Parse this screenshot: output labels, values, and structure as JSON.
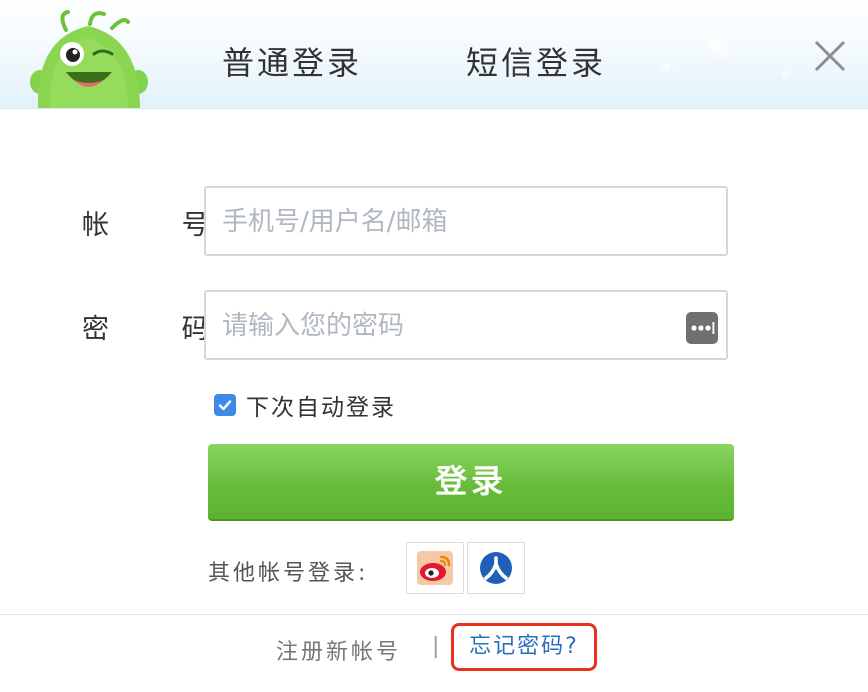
{
  "header": {
    "tabs": [
      {
        "label": "普通登录"
      },
      {
        "label": "短信登录"
      }
    ]
  },
  "form": {
    "account_label": "帐 号",
    "account_placeholder": "手机号/用户名/邮箱",
    "password_label": "密 码",
    "password_placeholder": "请输入您的密码",
    "remember_label": "下次自动登录",
    "remember_checked": true,
    "login_button": "登录"
  },
  "social": {
    "label": "其他帐号登录:",
    "providers": [
      "weibo-icon",
      "renren-icon"
    ]
  },
  "footer": {
    "register_link": "注册新帐号",
    "separator": "|",
    "forgot_link": "忘记密码?"
  },
  "colors": {
    "primary_button": "#67bd3b",
    "checkbox": "#3d8be6",
    "link": "#2a6fbf",
    "highlight": "#e8321c"
  }
}
